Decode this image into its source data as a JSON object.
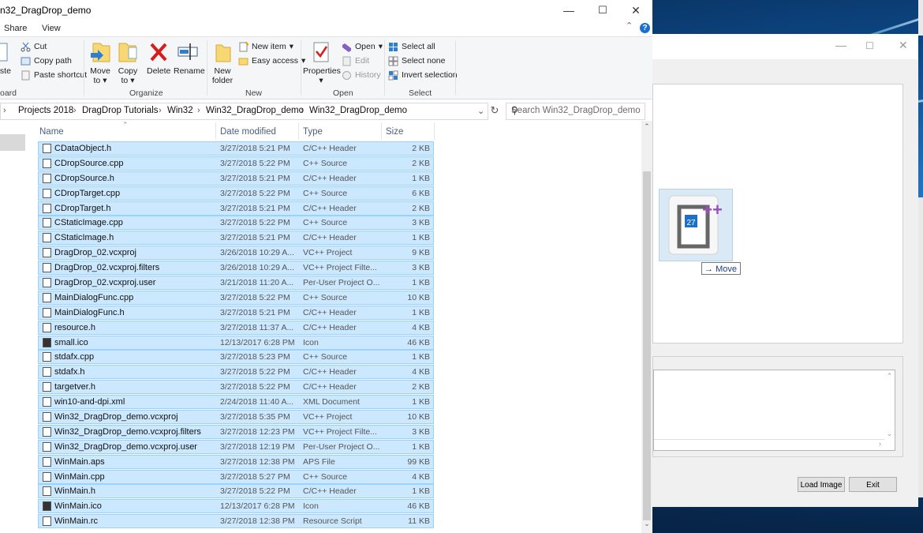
{
  "explorer": {
    "title": "n32_DragDrop_demo",
    "menu": {
      "share": "Share",
      "view": "View"
    },
    "ribbon": {
      "clipboard": {
        "paste": "aste",
        "cut": "Cut",
        "copy_path": "Copy path",
        "paste_shortcut": "Paste shortcut",
        "label": "oard"
      },
      "organize": {
        "move_to": "Move",
        "move_to_sub": "to",
        "copy_to": "Copy",
        "copy_to_sub": "to",
        "delete": "Delete",
        "rename": "Rename",
        "label": "Organize"
      },
      "new": {
        "new_folder": "New",
        "new_folder_sub": "folder",
        "new_item": "New item",
        "easy_access": "Easy access",
        "label": "New"
      },
      "open": {
        "properties": "Properties",
        "open": "Open",
        "edit": "Edit",
        "history": "History",
        "label": "Open"
      },
      "select": {
        "select_all": "Select all",
        "select_none": "Select none",
        "invert": "Invert selection",
        "label": "Select"
      }
    },
    "breadcrumbs": [
      "Projects 2018",
      "DragDrop Tutorials",
      "Win32",
      "Win32_DragDrop_demo",
      "Win32_DragDrop_demo"
    ],
    "search_placeholder": "Search Win32_DragDrop_demo",
    "columns": {
      "name": "Name",
      "date": "Date modified",
      "type": "Type",
      "size": "Size"
    },
    "files": [
      {
        "name": "CDataObject.h",
        "date": "3/27/2018 5:21 PM",
        "type": "C/C++ Header",
        "size": "2 KB",
        "icon": "header-file-icon"
      },
      {
        "name": "CDropSource.cpp",
        "date": "3/27/2018 5:22 PM",
        "type": "C++ Source",
        "size": "2 KB",
        "icon": "cpp-file-icon"
      },
      {
        "name": "CDropSource.h",
        "date": "3/27/2018 5:21 PM",
        "type": "C/C++ Header",
        "size": "1 KB",
        "icon": "header-file-icon"
      },
      {
        "name": "CDropTarget.cpp",
        "date": "3/27/2018 5:22 PM",
        "type": "C++ Source",
        "size": "6 KB",
        "icon": "cpp-file-icon"
      },
      {
        "name": "CDropTarget.h",
        "date": "3/27/2018 5:21 PM",
        "type": "C/C++ Header",
        "size": "2 KB",
        "icon": "header-file-icon"
      },
      {
        "name": "CStaticImage.cpp",
        "date": "3/27/2018 5:22 PM",
        "type": "C++ Source",
        "size": "3 KB",
        "icon": "cpp-file-icon"
      },
      {
        "name": "CStaticImage.h",
        "date": "3/27/2018 5:21 PM",
        "type": "C/C++ Header",
        "size": "1 KB",
        "icon": "header-file-icon"
      },
      {
        "name": "DragDrop_02.vcxproj",
        "date": "3/26/2018 10:29 A...",
        "type": "VC++ Project",
        "size": "9 KB",
        "icon": "vcxproj-file-icon"
      },
      {
        "name": "DragDrop_02.vcxproj.filters",
        "date": "3/26/2018 10:29 A...",
        "type": "VC++ Project Filte...",
        "size": "3 KB",
        "icon": "filters-file-icon"
      },
      {
        "name": "DragDrop_02.vcxproj.user",
        "date": "3/21/2018 11:20 A...",
        "type": "Per-User Project O...",
        "size": "1 KB",
        "icon": "user-file-icon"
      },
      {
        "name": "MainDialogFunc.cpp",
        "date": "3/27/2018 5:22 PM",
        "type": "C++ Source",
        "size": "10 KB",
        "icon": "cpp-file-icon"
      },
      {
        "name": "MainDialogFunc.h",
        "date": "3/27/2018 5:21 PM",
        "type": "C/C++ Header",
        "size": "1 KB",
        "icon": "header-file-icon"
      },
      {
        "name": "resource.h",
        "date": "3/27/2018 11:37 A...",
        "type": "C/C++ Header",
        "size": "4 KB",
        "icon": "header-file-icon"
      },
      {
        "name": "small.ico",
        "date": "12/13/2017 6:28 PM",
        "type": "Icon",
        "size": "46 KB",
        "icon": "ico-file-icon"
      },
      {
        "name": "stdafx.cpp",
        "date": "3/27/2018 5:23 PM",
        "type": "C++ Source",
        "size": "1 KB",
        "icon": "cpp-file-icon"
      },
      {
        "name": "stdafx.h",
        "date": "3/27/2018 5:22 PM",
        "type": "C/C++ Header",
        "size": "4 KB",
        "icon": "header-file-icon"
      },
      {
        "name": "targetver.h",
        "date": "3/27/2018 5:22 PM",
        "type": "C/C++ Header",
        "size": "2 KB",
        "icon": "header-file-icon"
      },
      {
        "name": "win10-and-dpi.xml",
        "date": "2/24/2018 11:40 A...",
        "type": "XML Document",
        "size": "1 KB",
        "icon": "xml-file-icon"
      },
      {
        "name": "Win32_DragDrop_demo.vcxproj",
        "date": "3/27/2018 5:35 PM",
        "type": "VC++ Project",
        "size": "10 KB",
        "icon": "vcxproj-file-icon"
      },
      {
        "name": "Win32_DragDrop_demo.vcxproj.filters",
        "date": "3/27/2018 12:23 PM",
        "type": "VC++ Project Filte...",
        "size": "3 KB",
        "icon": "filters-file-icon"
      },
      {
        "name": "Win32_DragDrop_demo.vcxproj.user",
        "date": "3/27/2018 12:19 PM",
        "type": "Per-User Project O...",
        "size": "1 KB",
        "icon": "user-file-icon"
      },
      {
        "name": "WinMain.aps",
        "date": "3/27/2018 12:38 PM",
        "type": "APS File",
        "size": "99 KB",
        "icon": "generic-file-icon"
      },
      {
        "name": "WinMain.cpp",
        "date": "3/27/2018 5:27 PM",
        "type": "C++ Source",
        "size": "4 KB",
        "icon": "cpp-file-icon"
      },
      {
        "name": "WinMain.h",
        "date": "3/27/2018 5:22 PM",
        "type": "C/C++ Header",
        "size": "1 KB",
        "icon": "header-file-icon"
      },
      {
        "name": "WinMain.ico",
        "date": "12/13/2017 6:28 PM",
        "type": "Icon",
        "size": "46 KB",
        "icon": "ico-file-icon"
      },
      {
        "name": "WinMain.rc",
        "date": "3/27/2018 12:38 PM",
        "type": "Resource Script",
        "size": "11 KB",
        "icon": "rc-file-icon"
      }
    ]
  },
  "dialog": {
    "load_image": "Load Image",
    "exit": "Exit"
  },
  "drag": {
    "badge": "27",
    "plus": "++",
    "tooltip": "Move"
  },
  "colors": {
    "selection_bg": "#cce8ff",
    "selection_border": "#99d1ff",
    "accent": "#1a6fd1"
  }
}
